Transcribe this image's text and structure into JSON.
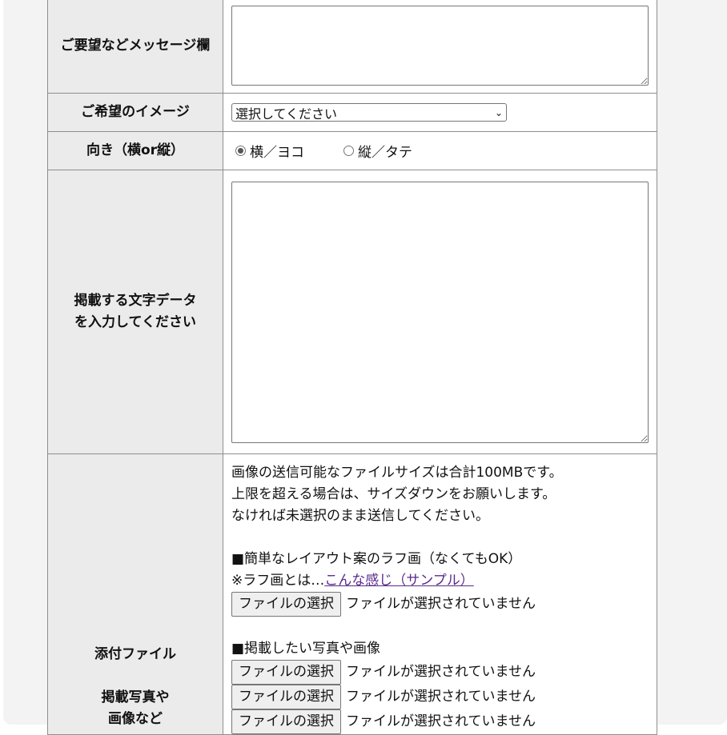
{
  "form": {
    "message": {
      "label": "ご要望などメッセージ欄",
      "value": ""
    },
    "image_pref": {
      "label": "ご希望のイメージ",
      "selected": "選択してください"
    },
    "orientation": {
      "label": "向き（横or縦）",
      "options": [
        {
          "label": "横／ヨコ",
          "checked": true
        },
        {
          "label": "縦／タテ",
          "checked": false
        }
      ]
    },
    "text_data": {
      "label_line1": "掲載する文字データ",
      "label_line2": "を入力してください",
      "value": ""
    },
    "attachments": {
      "label_line1": "添付ファイル",
      "label_line2": "掲載写真や",
      "label_line3": "画像など",
      "notes": [
        "画像の送信可能なファイルサイズは合計100MBです。",
        "上限を超える場合は、サイズダウンをお願いします。",
        "なければ未選択のまま送信してください。"
      ],
      "rough_heading": "■簡単なレイアウト案のラフ画（なくてもOK）",
      "rough_note_prefix": "※ラフ画とは…",
      "rough_link": "こんな感じ（サンプル）",
      "photos_heading": "■掲載したい写真や画像",
      "file_button": "ファイルの選択",
      "file_status": "ファイルが選択されていません"
    }
  }
}
